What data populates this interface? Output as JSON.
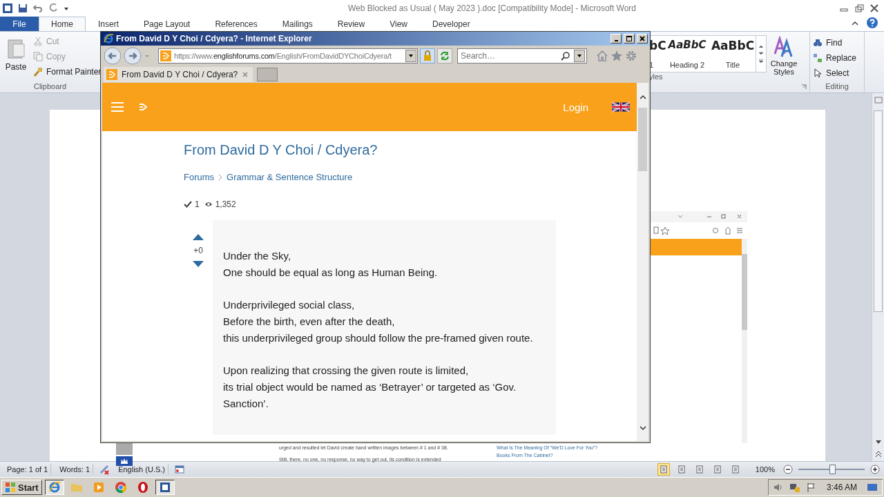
{
  "word": {
    "title": "Web Blocked as Usual ( May 2023 ).doc [Compatibility Mode]  -  Microsoft Word",
    "ribbon_tabs": [
      {
        "label": "File",
        "selected": false,
        "kind": "file"
      },
      {
        "label": "Home",
        "selected": true,
        "kind": "tab"
      },
      {
        "label": "Insert",
        "selected": false,
        "kind": "tab"
      },
      {
        "label": "Page Layout",
        "selected": false,
        "kind": "tab"
      },
      {
        "label": "References",
        "selected": false,
        "kind": "tab"
      },
      {
        "label": "Mailings",
        "selected": false,
        "kind": "tab"
      },
      {
        "label": "Review",
        "selected": false,
        "kind": "tab"
      },
      {
        "label": "View",
        "selected": false,
        "kind": "tab"
      },
      {
        "label": "Developer",
        "selected": false,
        "kind": "tab"
      }
    ],
    "clipboard": {
      "paste": "Paste",
      "label": "Clipboard",
      "items": [
        {
          "label": "Cut",
          "disabled": true,
          "kind": "cut"
        },
        {
          "label": "Copy",
          "disabled": true,
          "kind": "copy"
        },
        {
          "label": "Format Painter",
          "disabled": false,
          "kind": "brush"
        }
      ]
    },
    "styles": {
      "label": "yles",
      "items": [
        {
          "sample": "bC",
          "name": "1",
          "kind": "plain"
        },
        {
          "sample": "AaBbC",
          "name": "Heading 2",
          "kind": "italic"
        },
        {
          "sample": "AaBbC",
          "name": "Title",
          "kind": "title"
        }
      ],
      "change_styles": "Change Styles"
    },
    "editing": {
      "label": "Editing",
      "items": [
        {
          "label": "Find",
          "kind": "find"
        },
        {
          "label": "Replace",
          "kind": "replace"
        },
        {
          "label": "Select",
          "kind": "select"
        }
      ]
    },
    "document_text": [
      "urged and resulted let David create hand written images between # 1 and # 38.",
      "Still, there, no one, no response, no way to get out, its condition is extended"
    ],
    "document_links": [
      "What Is The Meaning Of “We'D Love For You”?",
      "Books From The Cabinet?"
    ],
    "status_bar": {
      "page": "Page: 1 of 1",
      "words": "Words: 1",
      "language": "English (U.S.)",
      "zoom": "100%",
      "zoom_slider": {
        "level": 0.5
      },
      "views": [
        {
          "selected": true
        },
        {
          "selected": false
        },
        {
          "selected": false
        },
        {
          "selected": false
        },
        {
          "selected": false
        }
      ]
    }
  },
  "browser": {
    "title": "From David D Y Choi / Cdyera? - Internet Explorer",
    "url": {
      "scheme": "https://www.",
      "domain": "englishforums.com",
      "path": "/English/FromDavidDYChoiCdyera/t"
    },
    "search": {
      "placeholder": "Search…"
    },
    "tabs": [
      {
        "label": "From David D Y Choi / Cdyera?",
        "selected": true
      }
    ],
    "page": {
      "login": "Login",
      "title": "From David D Y Choi / Cdyera?",
      "breadcrumbs": [
        "Forums",
        "Grammar & Sentence Structure"
      ],
      "answers": "1",
      "views": "1,352",
      "votes": "+0",
      "paragraphs": [
        [
          "Under the Sky,",
          "One should be equal as long as Human Being."
        ],
        [
          "Underprivileged social class,",
          "Before the birth, even after the death,",
          "this underprivileged group should follow the pre-framed given route."
        ],
        [
          "Upon realizing that crossing the given route is limited,",
          "its trial object would be named as ‘Betrayer’ or targeted as ‘Gov. Sanction’."
        ]
      ]
    }
  },
  "taskbar": {
    "start": "Start",
    "clock": "3:46 AM",
    "apps": [
      {
        "kind": "ie",
        "selected": true
      },
      {
        "kind": "folder",
        "selected": false
      },
      {
        "kind": "media",
        "selected": false
      },
      {
        "kind": "chrome",
        "selected": false
      },
      {
        "kind": "opera",
        "selected": false
      },
      {
        "kind": "word",
        "selected": true
      }
    ]
  }
}
